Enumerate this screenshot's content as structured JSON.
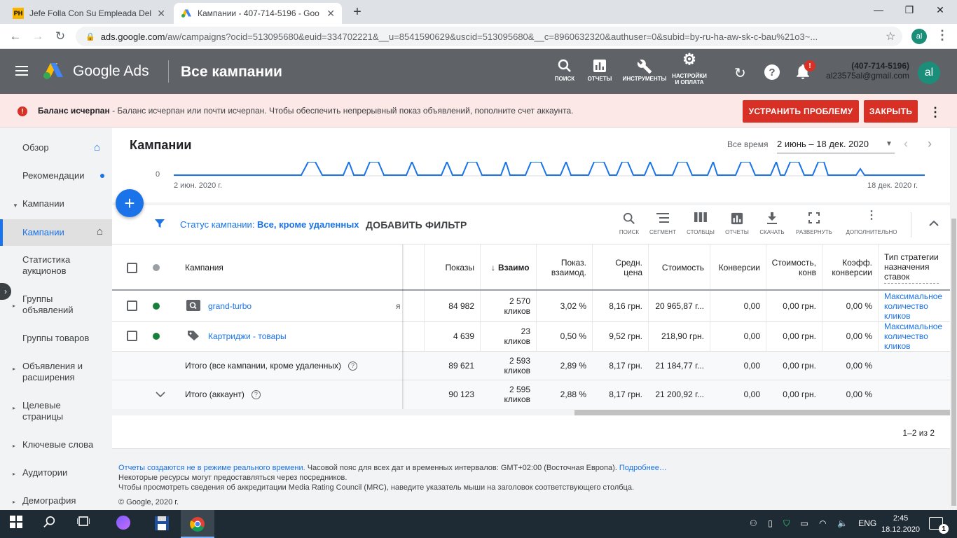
{
  "browser": {
    "tabs": [
      {
        "favicon": "PH",
        "title": "Jefe Folla Con Su Empleada Del S",
        "active": false
      },
      {
        "favicon": "google-ads-logo",
        "title": "Кампании - 407-714-5196 - Goo",
        "active": true
      }
    ],
    "url_host": "ads.google.com",
    "url_path": "/aw/campaigns?ocid=513095680&euid=334702221&__u=8541590629&uscid=513095680&__c=8960632320&authuser=0&subid=by-ru-ha-aw-sk-c-bau%21o3~...",
    "profile_initials": "al"
  },
  "header": {
    "product": "Google Ads",
    "title": "Все кампании",
    "tools": [
      {
        "label": "ПОИСК",
        "icon": "search-icon"
      },
      {
        "label": "ОТЧЕТЫ",
        "icon": "reports-icon"
      },
      {
        "label": "ИНСТРУМЕНТЫ",
        "icon": "wrench-icon"
      },
      {
        "label1": "НАСТРОЙКИ",
        "label2": "И ОПЛАТА",
        "icon": "gear-icon"
      }
    ],
    "notification_badge": "!",
    "account_phone": "(407-714-5196)",
    "account_email": "al23575al@gmail.com",
    "avatar": "al"
  },
  "alert": {
    "bold": "Баланс исчерпан",
    "text": " - Баланс исчерпан или почти исчерпан. Чтобы обеспечить непрерывный показ объявлений, пополните счет аккаунта.",
    "fix_label": "УСТРАНИТЬ ПРОБЛЕМУ",
    "close_label": "ЗАКРЫТЬ"
  },
  "sidebar": {
    "items": [
      {
        "l1": "Обзор",
        "l2": ""
      },
      {
        "l1": "Рекомендации",
        "l2": ""
      },
      {
        "l1": "Кампании",
        "l2": ""
      },
      {
        "l1": "Кампании",
        "l2": ""
      },
      {
        "l1": "Статистика",
        "l2": "аукционов"
      },
      {
        "l1": "Группы",
        "l2": "объявлений"
      },
      {
        "l1": "Группы товаров",
        "l2": ""
      },
      {
        "l1": "Объявления и",
        "l2": "расширения"
      },
      {
        "l1": "Целевые",
        "l2": "страницы"
      },
      {
        "l1": "Ключевые слова",
        "l2": ""
      },
      {
        "l1": "Аудитории",
        "l2": ""
      },
      {
        "l1": "Демография",
        "l2": ""
      }
    ]
  },
  "main": {
    "page_title": "Кампании",
    "range_label": "Все время",
    "range_value": "2 июнь – 18 дек. 2020",
    "chart": {
      "y_zero": "0",
      "x_start": "2 июн. 2020 г.",
      "x_end": "18 дек. 2020 г."
    },
    "filter": {
      "prefix": "Статус кампании: ",
      "value": "Все, кроме удаленных",
      "add_label": "ДОБАВИТЬ ФИЛЬТР"
    },
    "toolbar": [
      {
        "label": "ПОИСК",
        "icon": "search-icon"
      },
      {
        "label": "СЕГМЕНТ",
        "icon": "segment-icon"
      },
      {
        "label": "СТОЛБЦЫ",
        "icon": "columns-icon"
      },
      {
        "label": "ОТЧЕТЫ",
        "icon": "reports-icon"
      },
      {
        "label": "СКАЧАТЬ",
        "icon": "download-icon"
      },
      {
        "label": "РАЗВЕРНУТЬ",
        "icon": "fullscreen-icon"
      },
      {
        "label": "ДОПОЛНИТЕЛЬНО",
        "icon": "more-vert-icon"
      }
    ]
  },
  "table": {
    "headers": {
      "campaign": "Кампания",
      "impressions": "Показы",
      "interactions": "Взаимо",
      "interaction_rate1": "Показ.",
      "interaction_rate2": "взаимод.",
      "avg_cost1": "Средн.",
      "avg_cost2": "цена",
      "cost": "Стоимость",
      "conversions": "Конверсии",
      "cost_conv1": "Стоимость,",
      "cost_conv2": "конв",
      "conv_rate1": "Коэфф.",
      "conv_rate2": "конверсии",
      "bid_strategy1": "Тип стратегии",
      "bid_strategy2": "назначения",
      "bid_strategy3": "ставок"
    },
    "rows": [
      {
        "name": "grand-turbo",
        "icon": "search-campaign-icon",
        "status_color": "#188038",
        "partial": "я",
        "impressions": "84 982",
        "inter1": "2 570",
        "inter2": "кликов",
        "rate": "3,02 %",
        "avg": "8,16 грн.",
        "cost": "20 965,87 г...",
        "conv": "0,00",
        "cpc": "0,00 грн.",
        "cr": "0,00 %",
        "bid1": "Максимальное",
        "bid2": "количество",
        "bid3": "кликов"
      },
      {
        "name": "Картриджи - товары",
        "icon": "shopping-tag-icon",
        "status_color": "#188038",
        "partial": "",
        "impressions": "4 639",
        "inter1": "23",
        "inter2": "кликов",
        "rate": "0,50 %",
        "avg": "9,52 грн.",
        "cost": "218,90 грн.",
        "conv": "0,00",
        "cpc": "0,00 грн.",
        "cr": "0,00 %",
        "bid1": "Максимальное",
        "bid2": "количество",
        "bid3": "кликов"
      }
    ],
    "totals": [
      {
        "label": "Итого (все кампании, кроме удаленных)",
        "impressions": "89 621",
        "inter1": "2 593",
        "inter2": "кликов",
        "rate": "2,89 %",
        "avg": "8,17 грн.",
        "cost": "21 184,77 г...",
        "conv": "0,00",
        "cpc": "0,00 грн.",
        "cr": "0,00 %"
      },
      {
        "label": "Итого (аккаунт)",
        "impressions": "90 123",
        "inter1": "2 595",
        "inter2": "кликов",
        "rate": "2,88 %",
        "avg": "8,17 грн.",
        "cost": "21 200,92 г...",
        "conv": "0,00",
        "cpc": "0,00 грн.",
        "cr": "0,00 %"
      }
    ],
    "pager": "1–2 из 2"
  },
  "footer": {
    "line1_link": "Отчеты создаются не в режиме реального времени.",
    "line1_text": " Часовой пояс для всех дат и временных интервалов: GMT+02:00 (Восточная Европа). ",
    "line1_more": "Подробнее…",
    "line2": "Некоторые ресурсы могут предоставляться через посредников.",
    "line3": "Чтобы просмотреть сведения об аккредитации Media Rating Council (MRC), наведите указатель мыши на заголовок соответствующего столбца.",
    "line4": "© Google, 2020 г."
  },
  "taskbar": {
    "lang": "ENG",
    "time": "2:45",
    "date": "18.12.2020",
    "notif_count": "1"
  },
  "colors": {
    "accent": "#1a73e8",
    "header": "#5f6368",
    "alert_bg": "#fce8e6",
    "danger": "#d93025",
    "status_green": "#188038"
  }
}
